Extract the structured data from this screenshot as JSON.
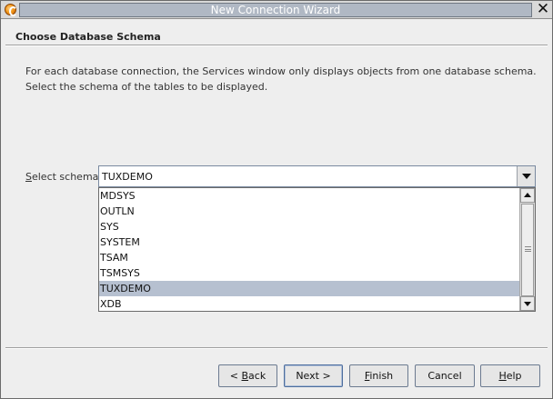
{
  "window": {
    "title": "New Connection Wizard",
    "close_glyph": "✕"
  },
  "step": {
    "title": "Choose Database Schema"
  },
  "description": {
    "line1": "For each database connection, the Services window only displays objects from one database schema.",
    "line2": "Select the schema of the tables to be displayed."
  },
  "schema": {
    "label_prefix": "",
    "label_mnemonic": "S",
    "label_rest": "elect schema:",
    "selected": "TUXDEMO",
    "options": [
      "MDSYS",
      "OUTLN",
      "SYS",
      "SYSTEM",
      "TSAM",
      "TSMSYS",
      "TUXDEMO",
      "XDB"
    ],
    "selected_index": 6
  },
  "buttons": {
    "back": {
      "pre": "< ",
      "mn": "B",
      "post": "ack"
    },
    "next": {
      "pre": "Next >",
      "mn": "",
      "post": ""
    },
    "finish": {
      "pre": "",
      "mn": "F",
      "post": "inish"
    },
    "cancel": {
      "pre": "Cancel",
      "mn": "",
      "post": ""
    },
    "help": {
      "pre": "",
      "mn": "H",
      "post": "elp"
    }
  },
  "colors": {
    "selection": "#b6c0d0",
    "titlebar": "#b0b8c4"
  },
  "icons": {
    "app": "app-logo-icon",
    "close": "close-icon",
    "combo_arrow": "chevron-down-icon"
  }
}
